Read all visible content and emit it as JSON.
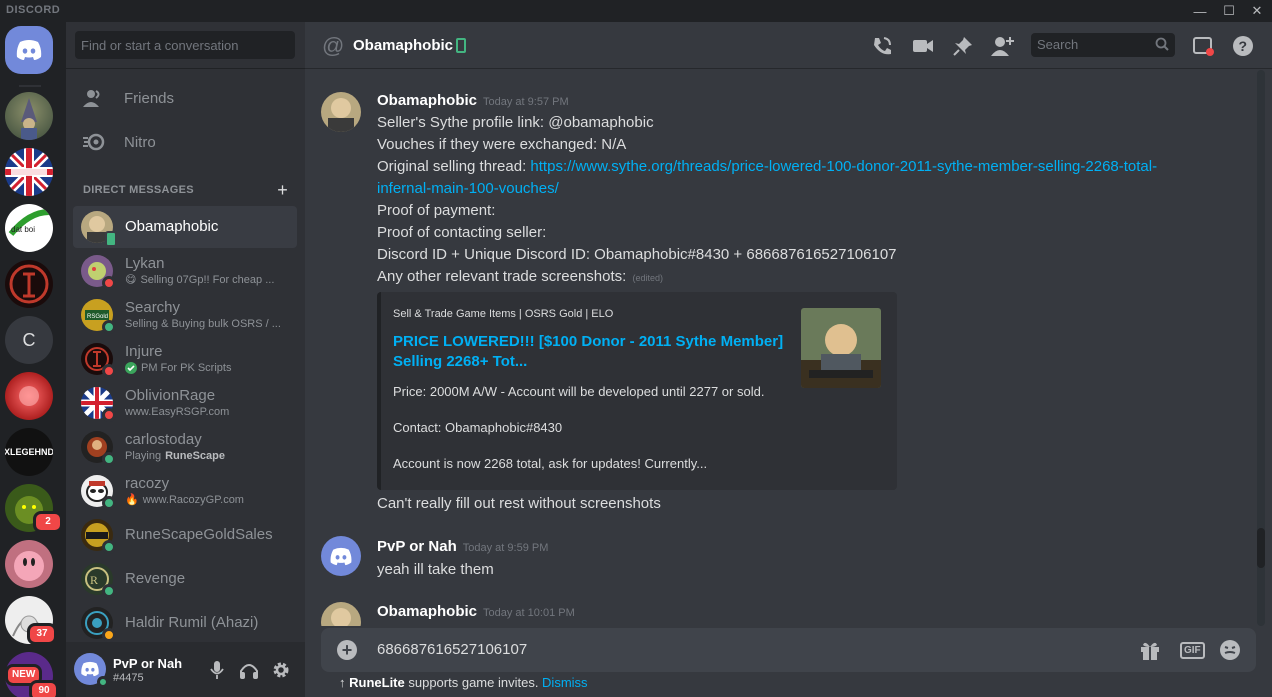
{
  "app": {
    "brand": "DISCORD",
    "window_controls": {
      "minimize": "—",
      "maximize": "☐",
      "close": "✕"
    }
  },
  "servers": [
    {
      "name": "home",
      "badge": ""
    },
    {
      "name": "wizard-server",
      "badge": ""
    },
    {
      "name": "EasyRSGP.com",
      "badge": ""
    },
    {
      "name": "dat boi",
      "badge": ""
    },
    {
      "name": "server-red-sigil",
      "badge": ""
    },
    {
      "name": "C",
      "badge": ""
    },
    {
      "name": "server-red-orb",
      "badge": ""
    },
    {
      "name": "XLEGEHND",
      "badge": ""
    },
    {
      "name": "goblin",
      "badge": "2"
    },
    {
      "name": "kirby",
      "badge": ""
    },
    {
      "name": "anime",
      "badge": "37"
    },
    {
      "name": "new-server",
      "badge": "NEW",
      "badge2": "90"
    }
  ],
  "sidebar": {
    "search_placeholder": "Find or start a conversation",
    "nav": [
      {
        "label": "Friends",
        "icon": "friends-icon"
      },
      {
        "label": "Nitro",
        "icon": "nitro-icon"
      }
    ],
    "dm_header": "DIRECT MESSAGES",
    "dm_add": "+",
    "dms": [
      {
        "name": "Obamaphobic",
        "sub": "",
        "status": "mobile",
        "active": true
      },
      {
        "name": "Lykan",
        "sub": "Selling 07Gp!! For cheap ...",
        "status": "dnd",
        "emoji": "😋"
      },
      {
        "name": "Searchy",
        "sub": "Selling & Buying bulk OSRS / ...",
        "status": "online"
      },
      {
        "name": "Injure",
        "sub": "PM For PK Scripts",
        "status": "dnd",
        "verified": true
      },
      {
        "name": "OblivionRage",
        "sub": "www.EasyRSGP.com",
        "status": "dnd"
      },
      {
        "name": "carlostoday",
        "sub_prefix": "Playing ",
        "sub_bold": "RuneScape",
        "status": "online"
      },
      {
        "name": "racozy",
        "sub": "www.RacozyGP.com",
        "status": "online",
        "emoji": "🔥"
      },
      {
        "name": "RuneScapeGoldSales",
        "sub": "",
        "status": "online"
      },
      {
        "name": "Revenge",
        "sub": "",
        "status": "online"
      },
      {
        "name": "Haldir Rumil (Ahazi)",
        "sub": "",
        "status": "idle"
      }
    ]
  },
  "user_panel": {
    "name": "PvP or Nah",
    "tag": "#4475"
  },
  "header": {
    "at": "@",
    "channel_name": "Obamaphobic",
    "search_placeholder": "Search"
  },
  "messages": {
    "m1": {
      "author": "Obamaphobic",
      "time": "Today at 9:57 PM",
      "lines": [
        "Seller's Sythe profile link: @obamaphobic",
        "Vouches if they were exchanged: N/A"
      ],
      "thread_label": "Original selling thread: ",
      "thread_link_1": "https://www.sythe.org/threads/price-lowered-100-donor-2011-sythe-member-selling-2268-total-",
      "thread_link_2": "infernal-main-100-vouches/",
      "lines2": [
        "Proof of payment:",
        "Proof of contacting seller:",
        "Discord ID + Unique Discord ID: Obamaphobic#8430 + 686687616527106107"
      ],
      "last_line": "Any other relevant trade screenshots:",
      "edited": "(edited)",
      "embed": {
        "provider": "Sell & Trade Game Items | OSRS Gold | ELO",
        "title": "PRICE LOWERED!!! [$100 Donor - 2011 Sythe Member] Selling 2268+ Tot...",
        "desc1": "Price: 2000M A/W - Account will be developed until 2277 or sold.",
        "desc2": "Contact: Obamaphobic#8430",
        "desc3": "Account is now 2268 total, ask for updates! Currently..."
      },
      "after_embed": "Can't really fill out rest without screenshots"
    },
    "m2": {
      "author": "PvP or Nah",
      "time": "Today at 9:59 PM",
      "text": "yeah ill take them"
    },
    "m3": {
      "author": "Obamaphobic",
      "time": "Today at 10:01 PM"
    }
  },
  "composer": {
    "value": "686687616527106107",
    "gif": "GIF"
  },
  "invite_bar": {
    "arrow": "↑",
    "app": "RuneLite",
    "text": " supports game invites. ",
    "dismiss": "Dismiss"
  },
  "colors": {
    "blurple": "#7289da",
    "link": "#00b0f4",
    "online": "#43b581",
    "dnd": "#f04747",
    "idle": "#faa61a"
  }
}
